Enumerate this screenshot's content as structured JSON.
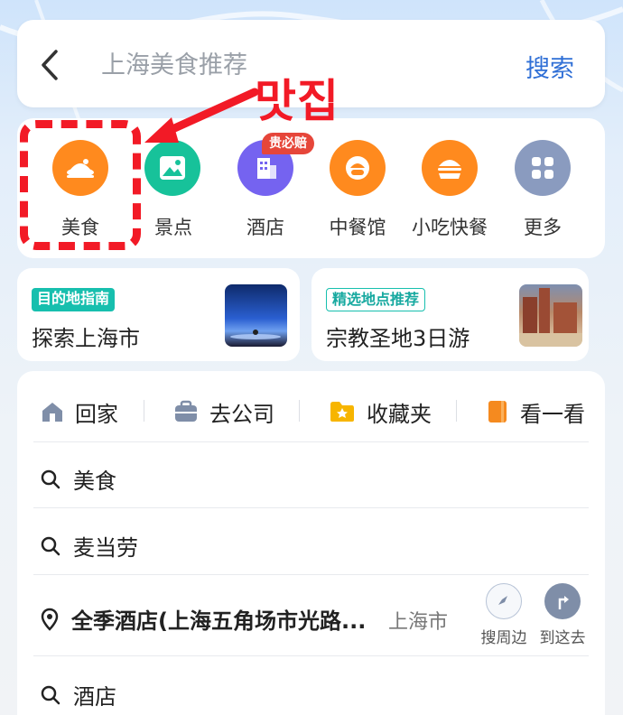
{
  "search": {
    "placeholder": "上海美食推荐",
    "button_label": "搜索"
  },
  "categories": [
    {
      "label": "美食",
      "icon": "food-dish-icon",
      "color": "#ff8a1e"
    },
    {
      "label": "景点",
      "icon": "landscape-image-icon",
      "color": "#17c29a"
    },
    {
      "label": "酒店",
      "icon": "hotel-building-icon",
      "color": "#7563f0",
      "badge": "贵必赔"
    },
    {
      "label": "中餐馆",
      "icon": "chinese-food-icon",
      "color": "#ff8a1e"
    },
    {
      "label": "小吃快餐",
      "icon": "burger-icon",
      "color": "#ff8a1e"
    },
    {
      "label": "更多",
      "icon": "grid-more-icon",
      "color": "#8a9bbf"
    }
  ],
  "destinations": [
    {
      "tag": "目的地指南",
      "title": "探索上海市"
    },
    {
      "tag": "精选地点推荐",
      "title": "宗教圣地3日游"
    }
  ],
  "quick_links": [
    {
      "label": "回家",
      "icon": "home-icon"
    },
    {
      "label": "去公司",
      "icon": "briefcase-icon"
    },
    {
      "label": "收藏夹",
      "icon": "star-folder-icon"
    },
    {
      "label": "看一看",
      "icon": "book-icon"
    }
  ],
  "history": [
    {
      "label": "美食",
      "icon": "search-icon"
    },
    {
      "label": "麦当劳",
      "icon": "search-icon"
    },
    {
      "label": "全季酒店(上海五角场市光路...",
      "icon": "location-pin-icon",
      "city": "上海市"
    },
    {
      "label": "酒店",
      "icon": "search-icon"
    }
  ],
  "actions": {
    "nearby_label": "搜周边",
    "go_label": "到这去"
  },
  "annotation": {
    "text": "맛집",
    "color": "#f21a26"
  }
}
